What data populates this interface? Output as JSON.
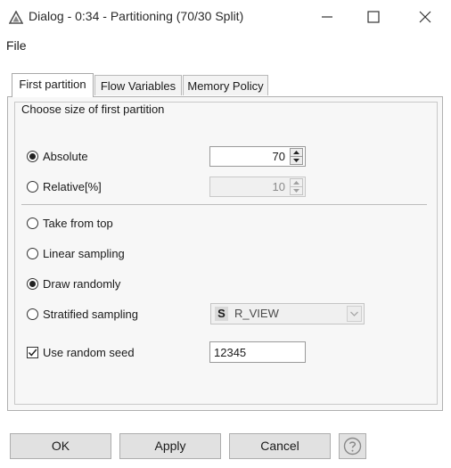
{
  "window": {
    "title": "Dialog - 0:34 - Partitioning (70/30 Split)",
    "icon": "triangle-app-icon"
  },
  "menu": {
    "file": "File"
  },
  "tabs": [
    {
      "label": "First partition",
      "active": true
    },
    {
      "label": "Flow Variables",
      "active": false
    },
    {
      "label": "Memory Policy",
      "active": false
    }
  ],
  "group": {
    "title": "Choose size of first partition"
  },
  "size": {
    "absolute_label": "Absolute",
    "absolute_value": "70",
    "absolute_selected": true,
    "relative_label": "Relative[%]",
    "relative_value": "10",
    "relative_selected": false
  },
  "sampling": {
    "take_from_top": "Take from top",
    "linear": "Linear sampling",
    "draw_randomly": "Draw randomly",
    "stratified": "Stratified sampling",
    "selected": "draw_randomly",
    "stratified_column_type": "S",
    "stratified_column": "R_VIEW"
  },
  "seed": {
    "label": "Use random seed",
    "checked": true,
    "value": "12345"
  },
  "buttons": {
    "ok": "OK",
    "apply": "Apply",
    "cancel": "Cancel",
    "help_icon": "question-mark-icon"
  }
}
